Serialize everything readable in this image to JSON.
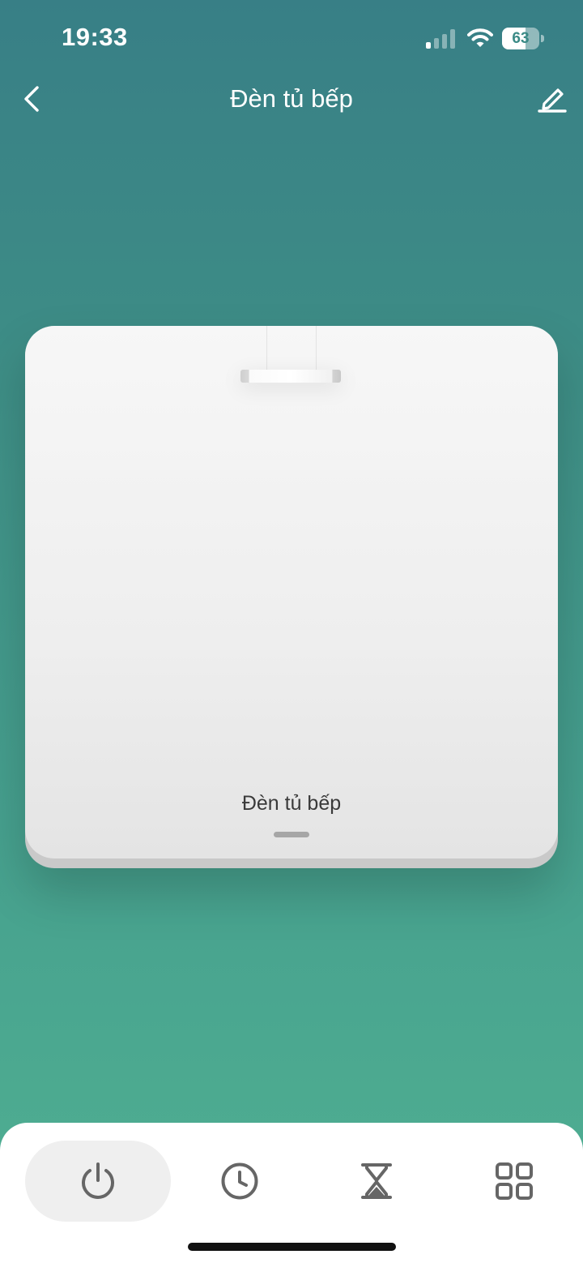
{
  "status_bar": {
    "time": "19:33",
    "battery_level": "63",
    "battery_fraction": 0.63,
    "signal_bars_active": 1,
    "signal_bars_total": 4
  },
  "header": {
    "title": "Đèn tủ bếp",
    "back_icon": "chevron-left-icon",
    "edit_icon": "pencil-icon"
  },
  "switch": {
    "label": "Đèn tủ bếp",
    "state": "off"
  },
  "tabs": [
    {
      "name": "power",
      "icon": "power-icon",
      "active": true
    },
    {
      "name": "schedule",
      "icon": "clock-icon",
      "active": false
    },
    {
      "name": "timer",
      "icon": "hourglass-icon",
      "active": false
    },
    {
      "name": "more",
      "icon": "grid-icon",
      "active": false
    }
  ],
  "colors": {
    "background_top": "#387f86",
    "background_bottom": "#50b092",
    "icon_gray": "#666666"
  }
}
